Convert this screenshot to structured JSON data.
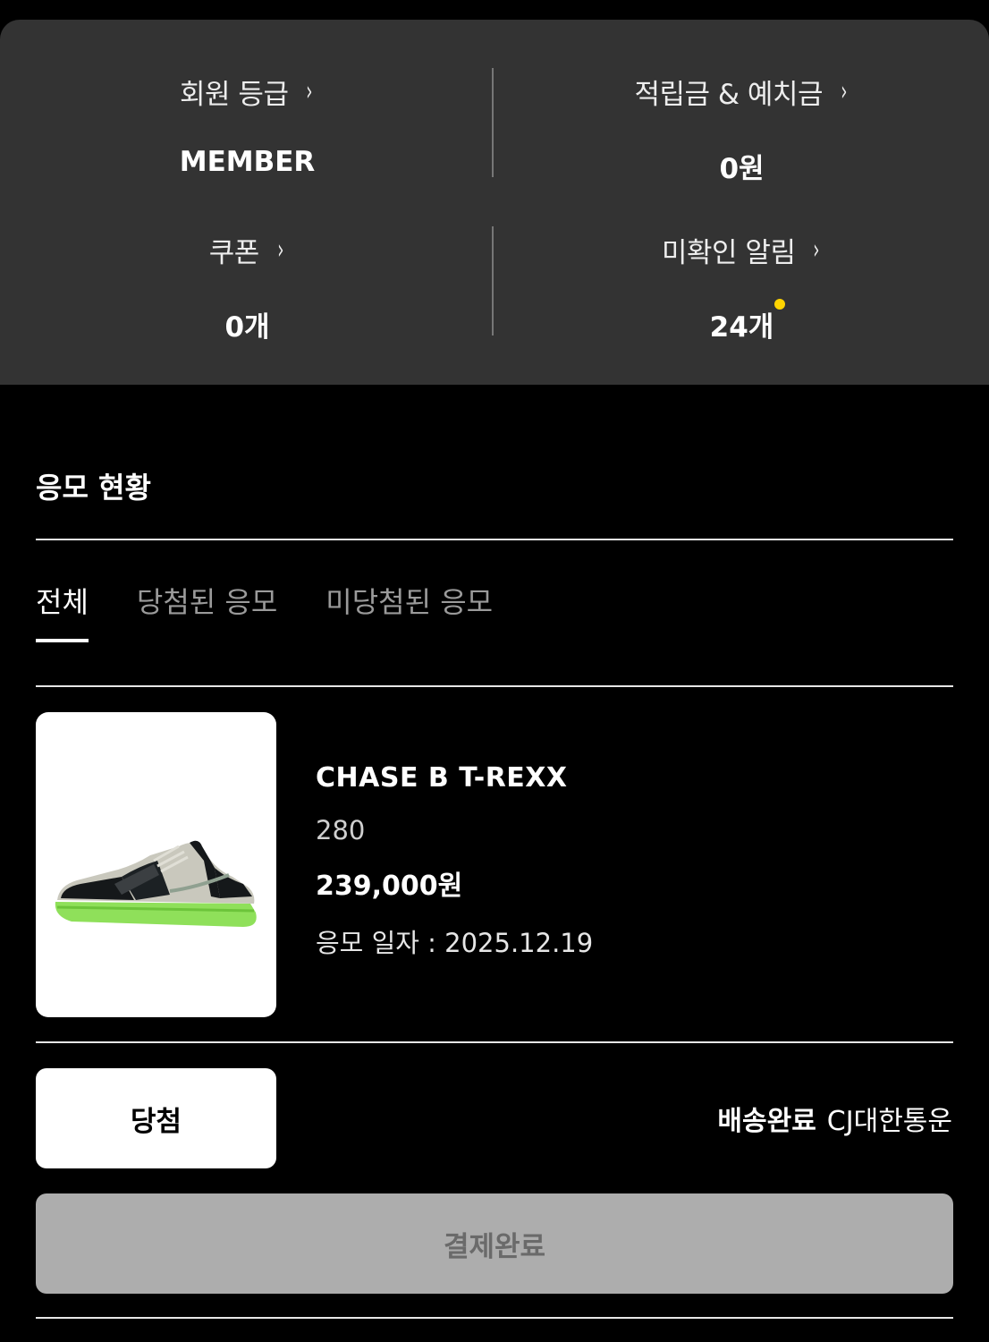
{
  "summary": {
    "membership": {
      "label": "회원 등급",
      "value": "MEMBER"
    },
    "points": {
      "label": "적립금 & 예치금",
      "value": "0원"
    },
    "coupons": {
      "label": "쿠폰",
      "value": "0개"
    },
    "notifications": {
      "label": "미확인 알림",
      "value": "24개",
      "unread_dot_color": "#ffd400"
    },
    "chevron": "›"
  },
  "entries": {
    "title": "응모 현황",
    "tabs": [
      {
        "label": "전체",
        "active": true
      },
      {
        "label": "당첨된 응모",
        "active": false
      },
      {
        "label": "미당첨된 응모",
        "active": false
      }
    ]
  },
  "item": {
    "name": "CHASE B T-REXX",
    "size": "280",
    "price": "239,000원",
    "date_label": "응모 일자 : 2025.12.19",
    "image_icon": "sneaker-image",
    "result_label": "당첨",
    "shipping_status": "배송완료",
    "carrier": "CJ대한통운",
    "payment_label": "결제완료"
  },
  "colors": {
    "card_bg": "#333333",
    "accent_dot": "#ffd400",
    "disabled_button": "#adadad"
  }
}
